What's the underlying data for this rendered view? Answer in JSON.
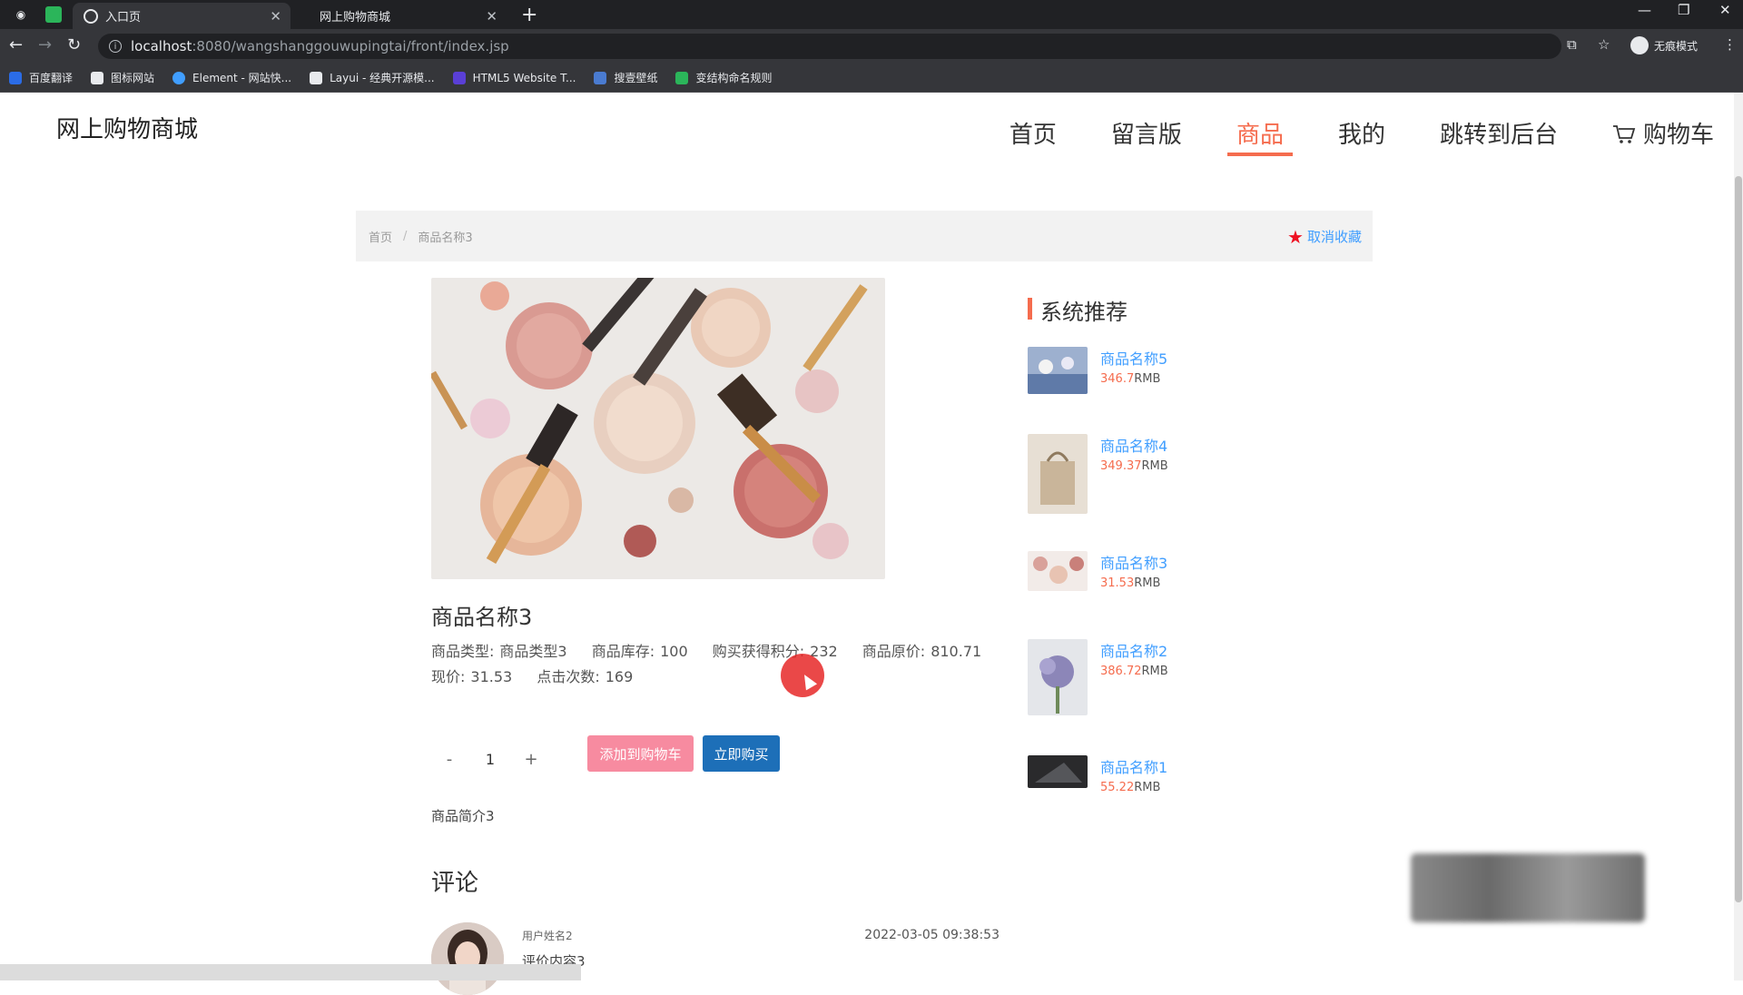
{
  "browser": {
    "tabs": [
      {
        "title": "入口页",
        "active": true
      },
      {
        "title": "网上购物商城",
        "active": false
      }
    ],
    "url_host": "localhost",
    "url_path": ":8080/wangshanggouwupingtai/front/index.jsp",
    "incognito_label": "无痕模式",
    "bookmarks": [
      {
        "label": "百度翻译",
        "color": "#2b6ce6"
      },
      {
        "label": "图标网站",
        "color": "#e8eaed"
      },
      {
        "label": "Element - 网站快...",
        "color": "#409eff"
      },
      {
        "label": "Layui - 经典开源模...",
        "color": "#e8eaed"
      },
      {
        "label": "HTML5 Website T...",
        "color": "#5a3fd6"
      },
      {
        "label": "搜壹壁纸",
        "color": "#4a7bd0"
      },
      {
        "label": "变结构命名规则",
        "color": "#2bb55a"
      }
    ]
  },
  "site": {
    "title": "网上购物商城",
    "nav": [
      "首页",
      "留言版",
      "商品",
      "我的",
      "跳转到后台",
      "购物车"
    ],
    "active_nav": "商品"
  },
  "breadcrumb": {
    "home": "首页",
    "current": "商品名称3"
  },
  "collect_label": "取消收藏",
  "product": {
    "name": "商品名称3",
    "info_row1": [
      {
        "label": "商品类型:",
        "value": "商品类型3"
      },
      {
        "label": "商品库存:",
        "value": "100"
      },
      {
        "label": "购买获得积分:",
        "value": "232"
      },
      {
        "label": "商品原价:",
        "value": "810.71"
      }
    ],
    "info_row2": [
      {
        "label": "现价:",
        "value": "31.53"
      },
      {
        "label": "点击次数:",
        "value": "169"
      }
    ],
    "quantity": "1",
    "minus": "-",
    "plus": "+",
    "add_to_cart": "添加到购物车",
    "buy_now": "立即购买",
    "intro": "商品简介3"
  },
  "comments": {
    "title": "评论",
    "items": [
      {
        "user": "用户姓名2",
        "text": "评价内容3",
        "time": "2022-03-05 09:38:53"
      }
    ]
  },
  "recommend": {
    "title": "系统推荐",
    "items": [
      {
        "name": "商品名称5",
        "price": "346.7",
        "unit": "RMB"
      },
      {
        "name": "商品名称4",
        "price": "349.37",
        "unit": "RMB"
      },
      {
        "name": "商品名称3",
        "price": "31.53",
        "unit": "RMB"
      },
      {
        "name": "商品名称2",
        "price": "386.72",
        "unit": "RMB"
      },
      {
        "name": "商品名称1",
        "price": "55.22",
        "unit": "RMB"
      }
    ]
  },
  "colors": {
    "accent": "#f56c4e",
    "link": "#409eff",
    "buy": "#1d6fb8",
    "cart": "#f78ba0"
  }
}
